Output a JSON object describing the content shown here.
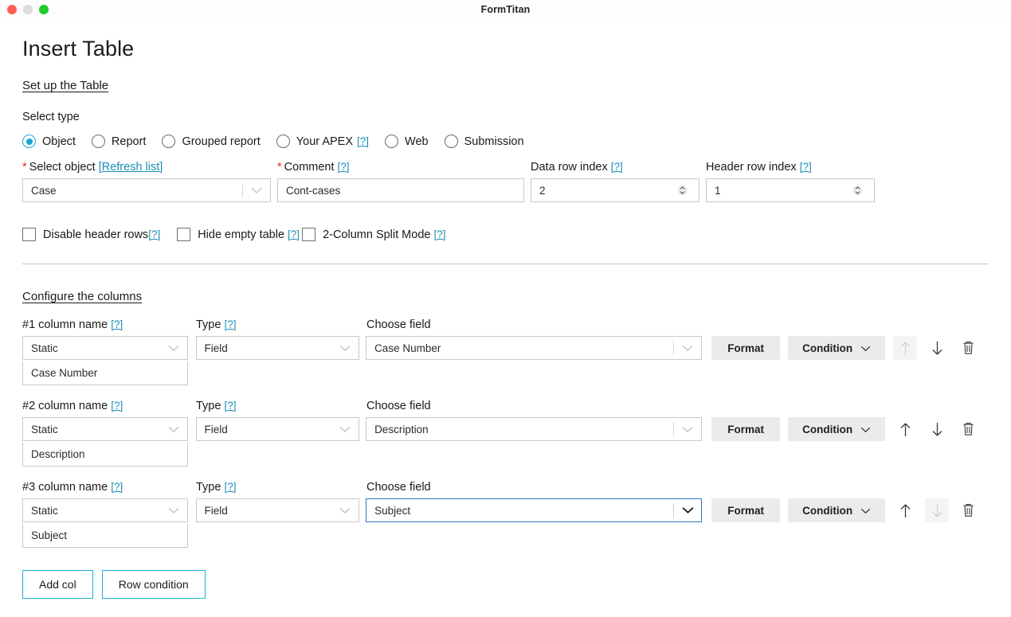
{
  "window": {
    "title": "FormTitan",
    "controls": [
      "close",
      "minimize",
      "zoom"
    ]
  },
  "page": {
    "title": "Insert Table",
    "setup_section": "Set up the Table",
    "columns_section": "Configure the columns"
  },
  "select_type": {
    "label": "Select type",
    "options": [
      {
        "label": "Object",
        "selected": true,
        "help": false
      },
      {
        "label": "Report",
        "selected": false,
        "help": false
      },
      {
        "label": "Grouped report",
        "selected": false,
        "help": false
      },
      {
        "label": "Your APEX",
        "selected": false,
        "help": true
      },
      {
        "label": "Web",
        "selected": false,
        "help": false
      },
      {
        "label": "Submission",
        "selected": false,
        "help": false
      }
    ],
    "help_text": "[?]"
  },
  "form": {
    "select_object": {
      "label": "Select object",
      "required": true,
      "refresh_link": "[Refresh list]",
      "value": "Case"
    },
    "comment": {
      "label": "Comment",
      "required": true,
      "help": "[?]",
      "value": "Cont-cases"
    },
    "data_row_index": {
      "label": "Data row index",
      "help": "[?]",
      "value": "2"
    },
    "header_row_index": {
      "label": "Header row index",
      "help": "[?]",
      "value": "1"
    }
  },
  "checkboxes": [
    {
      "label": "Disable header rows",
      "help": "[?]",
      "checked": false
    },
    {
      "label": "Hide empty table",
      "help": "[?]",
      "checked": false
    },
    {
      "label": "2-Column Split Mode",
      "help": "[?]",
      "checked": false
    }
  ],
  "columns_headers": {
    "name_suffix": "column name",
    "type": "Type",
    "choose_field": "Choose field",
    "help": "[?]"
  },
  "columns": [
    {
      "index": "#1",
      "name_label": "#1 column name",
      "type_value": "Static",
      "name_value": "Case Number",
      "field_type": "Field",
      "chosen_field": "Case Number",
      "format_label": "Format",
      "condition_label": "Condition",
      "up_enabled": false,
      "down_enabled": true,
      "field_focused": false
    },
    {
      "index": "#2",
      "name_label": "#2 column name",
      "type_value": "Static",
      "name_value": "Description",
      "field_type": "Field",
      "chosen_field": "Description",
      "format_label": "Format",
      "condition_label": "Condition",
      "up_enabled": true,
      "down_enabled": true,
      "field_focused": false
    },
    {
      "index": "#3",
      "name_label": "#3 column name",
      "type_value": "Static",
      "name_value": "Subject",
      "field_type": "Field",
      "chosen_field": "Subject",
      "format_label": "Format",
      "condition_label": "Condition",
      "up_enabled": true,
      "down_enabled": false,
      "field_focused": true
    }
  ],
  "footer": {
    "add_col": "Add col",
    "row_condition": "Row condition"
  },
  "colors": {
    "accent_link": "#1b8fb5",
    "radio_selected": "#1ba7d4",
    "focus_border": "#3272c8",
    "outline_button": "#1ab3d4",
    "required_asterisk": "#d62b2b",
    "button_bg": "#ebebeb"
  }
}
